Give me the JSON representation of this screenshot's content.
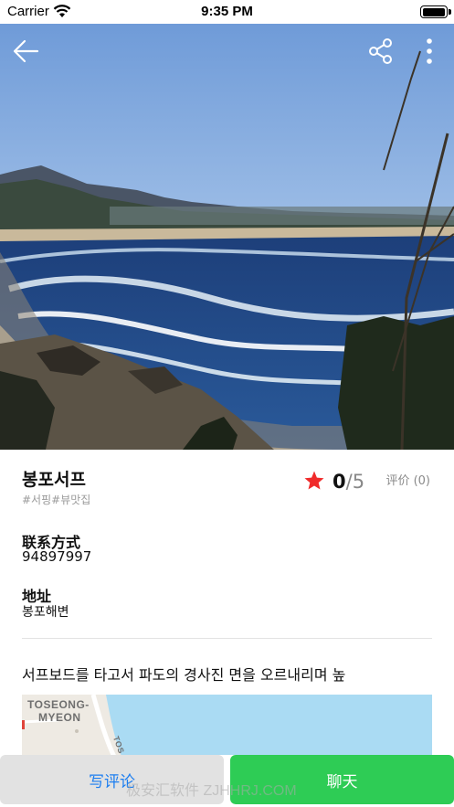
{
  "status_bar": {
    "carrier": "Carrier",
    "time": "9:35 PM",
    "battery_level": 0.9
  },
  "place": {
    "name": "봉포서프",
    "tags": "#서핑#뷰맛집",
    "rating_value": "0",
    "rating_max": "/5",
    "review_count": "评价 (0)",
    "contact_label": "联系方式",
    "contact_value": "94897997",
    "address_label": "地址",
    "address_value": "봉포해변",
    "description": "서프보드를 타고서 파도의 경사진 면을 오르내리며 높"
  },
  "map": {
    "label_line1": "TOSEONG-",
    "label_line2": "MYEON",
    "road_label": "TOS"
  },
  "actions": {
    "write_review": "写评论",
    "chat": "聊天"
  },
  "watermark": "极安汇软件 ZJHHRJ.COM",
  "colors": {
    "star": "#f02b2b",
    "chat_button": "#2ecc55",
    "review_text": "#1c7ef0"
  }
}
